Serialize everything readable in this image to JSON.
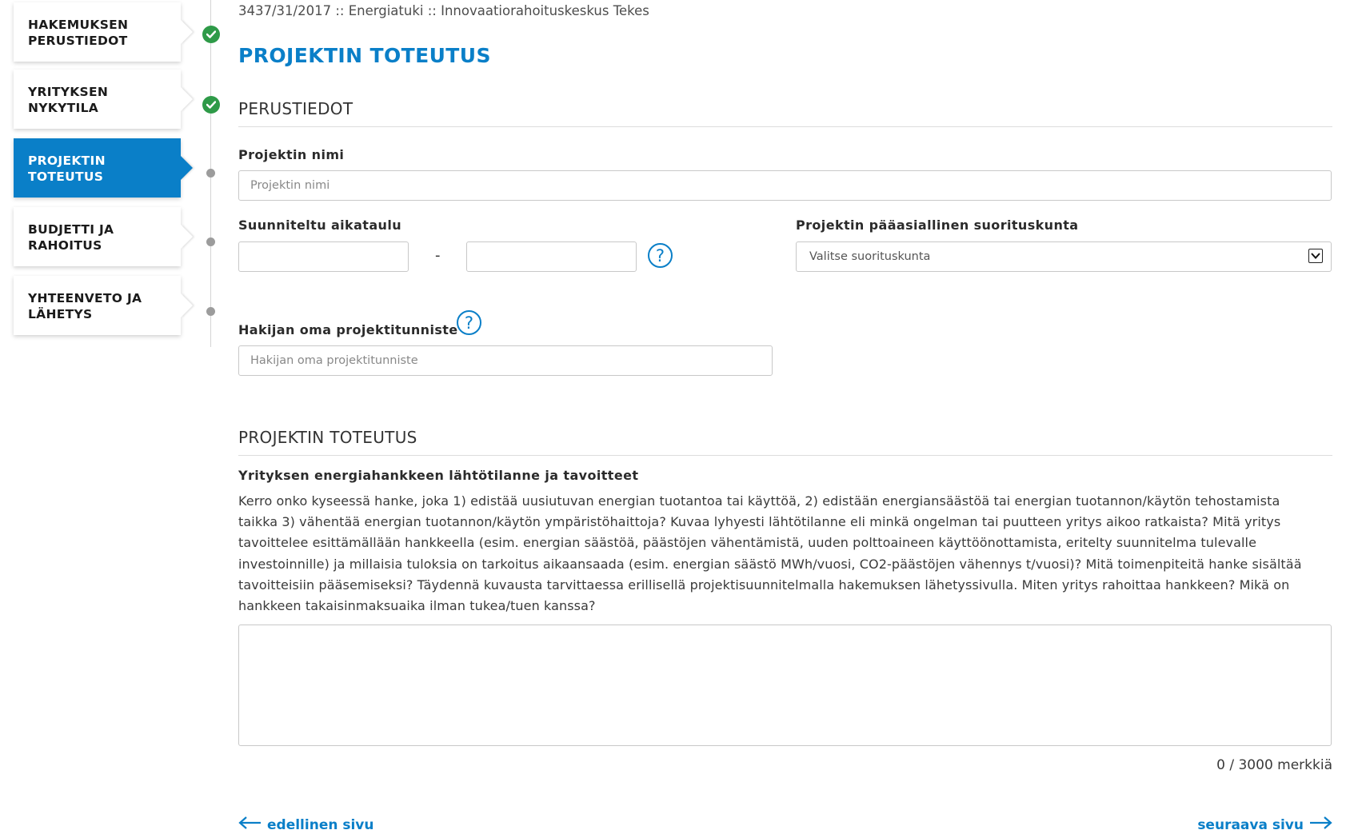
{
  "nav": {
    "items": [
      {
        "line1": "HAKEMUKSEN",
        "line2": "PERUSTIEDOT",
        "state": "done"
      },
      {
        "line1": "YRITYKSEN",
        "line2": "NYKYTILA",
        "state": "done"
      },
      {
        "line1": "PROJEKTIN",
        "line2": "TOTEUTUS",
        "state": "active"
      },
      {
        "line1": "BUDJETTI JA",
        "line2": "RAHOITUS",
        "state": "todo"
      },
      {
        "line1": "YHTEENVETO JA",
        "line2": "LÄHETYS",
        "state": "todo"
      }
    ]
  },
  "breadcrumb": "3437/31/2017 :: Energiatuki :: Innovaatiorahoituskeskus Tekes",
  "page_title": "PROJEKTIN TOTEUTUS",
  "perustiedot": {
    "section_title": "PERUSTIEDOT",
    "project_name_label": "Projektin nimi",
    "project_name_placeholder": "Projektin nimi",
    "project_name_value": "",
    "schedule_label": "Suunniteltu aikataulu",
    "schedule_start_value": "",
    "schedule_end_value": "",
    "schedule_separator": "-",
    "unit_label": "Projektin pääasiallinen suorituskunta",
    "unit_selected": "Valitse suorituskunta",
    "own_id_label": "Hakijan oma projektitunniste",
    "own_id_placeholder": "Hakijan oma projektitunniste",
    "own_id_value": ""
  },
  "toteutus": {
    "section_title": "PROJEKTIN TOTEUTUS",
    "question_label": "Yrityksen energiahankkeen lähtötilanne ja tavoitteet",
    "question_text": "Kerro onko kyseessä hanke, joka 1) edistää uusiutuvan energian tuotantoa tai käyttöä, 2) edistään energiansäästöä tai energian tuotannon/käytön tehostamista taikka 3) vähentää energian tuotannon/käytön ympäristöhaittoja? Kuvaa lyhyesti lähtötilanne eli minkä ongelman tai puutteen yritys aikoo ratkaista? Mitä yritys tavoittelee esittämällään hankkeella (esim. energian säästöä, päästöjen vähentämistä, uuden polttoaineen käyttöönottamista, eritelty suunnitelma tulevalle investoinnille) ja millaisia tuloksia on tarkoitus aikaansaada (esim. energian säästö MWh/vuosi, CO2-päästöjen vähennys t/vuosi)? Mitä toimenpiteitä hanke sisältää tavoitteisiin pääsemiseksi? Täydennä kuvausta tarvittaessa erillisellä projektisuunnitelmalla hakemuksen lähetyssivulla. Miten yritys rahoittaa hankkeen? Mikä on hankkeen takaisinmaksuaika ilman tukea/tuen kanssa?",
    "answer_value": "",
    "counter": "0 / 3000 merkkiä"
  },
  "pager": {
    "prev_label": "edellinen sivu",
    "next_label": "seuraava sivu"
  },
  "colors": {
    "accent": "#0a7fc8",
    "done": "#2e9a48",
    "pending_dot": "#9c9c9c"
  },
  "icons": {
    "done": "check-circle-icon",
    "help": "question-circle-icon",
    "select": "chevron-down-icon",
    "prev": "arrow-left-icon",
    "next": "arrow-right-icon"
  }
}
